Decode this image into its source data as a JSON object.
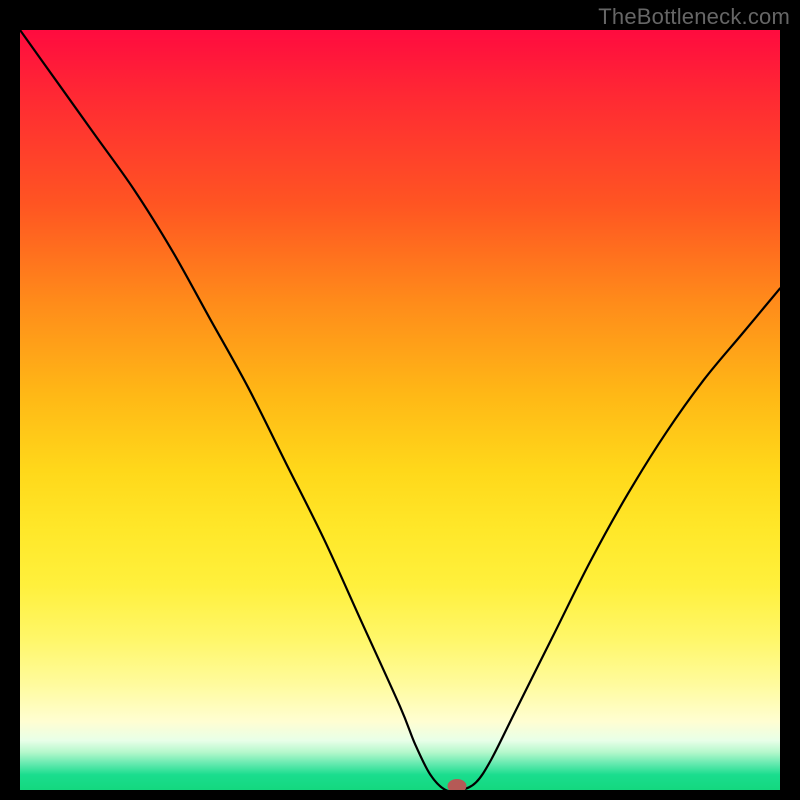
{
  "watermark": "TheBottleneck.com",
  "chart_data": {
    "type": "line",
    "title": "",
    "xlabel": "",
    "ylabel": "",
    "xlim": [
      0,
      100
    ],
    "ylim": [
      0,
      100
    ],
    "series": [
      {
        "name": "bottleneck-curve",
        "x": [
          0,
          5,
          10,
          15,
          20,
          25,
          30,
          35,
          40,
          45,
          50,
          52,
          54,
          56,
          58,
          60,
          62,
          65,
          70,
          75,
          80,
          85,
          90,
          95,
          100
        ],
        "y": [
          100,
          93,
          86,
          79,
          71,
          62,
          53,
          43,
          33,
          22,
          11,
          6,
          2,
          0,
          0,
          1,
          4,
          10,
          20,
          30,
          39,
          47,
          54,
          60,
          66
        ]
      }
    ],
    "marker": {
      "x": 57.5,
      "y": 0
    },
    "gradient_stops": [
      {
        "pos": 0,
        "color": "#ff0b3f"
      },
      {
        "pos": 0.5,
        "color": "#ffd81a"
      },
      {
        "pos": 0.9,
        "color": "#fffed2"
      },
      {
        "pos": 1.0,
        "color": "#14d87f"
      }
    ]
  }
}
